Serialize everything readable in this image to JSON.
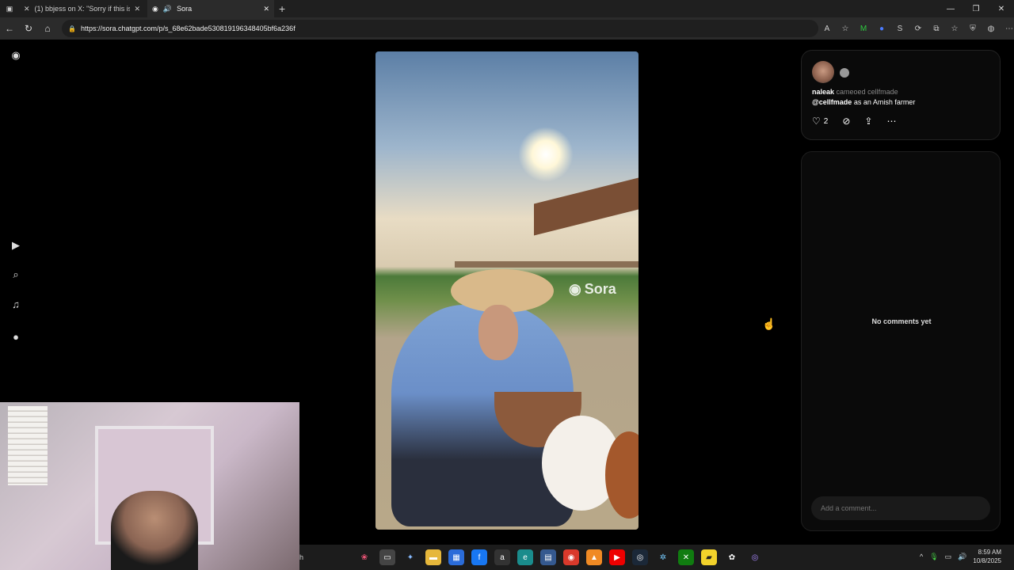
{
  "browser": {
    "tabs": [
      {
        "title": "(1) bbjess on X: \"Sorry if this is ou",
        "icon": "x-logo-icon"
      },
      {
        "title": "Sora",
        "icon": "sora-logo-icon",
        "audio": true
      }
    ],
    "url": "https://sora.chatgpt.com/p/s_68e62bade530819196348405bf6a236f"
  },
  "video": {
    "watermark": "Sora"
  },
  "post": {
    "author": "naleak",
    "cameo_text": "cameoed cellfmade",
    "mention": "@cellfmade",
    "caption_rest": "as an Amish farmer",
    "likes": "2"
  },
  "comments": {
    "empty_text": "No comments yet",
    "input_placeholder": "Add a comment..."
  },
  "taskbar": {
    "search_fragment": "h",
    "time": "8:59 AM",
    "date": "10/8/2025"
  }
}
